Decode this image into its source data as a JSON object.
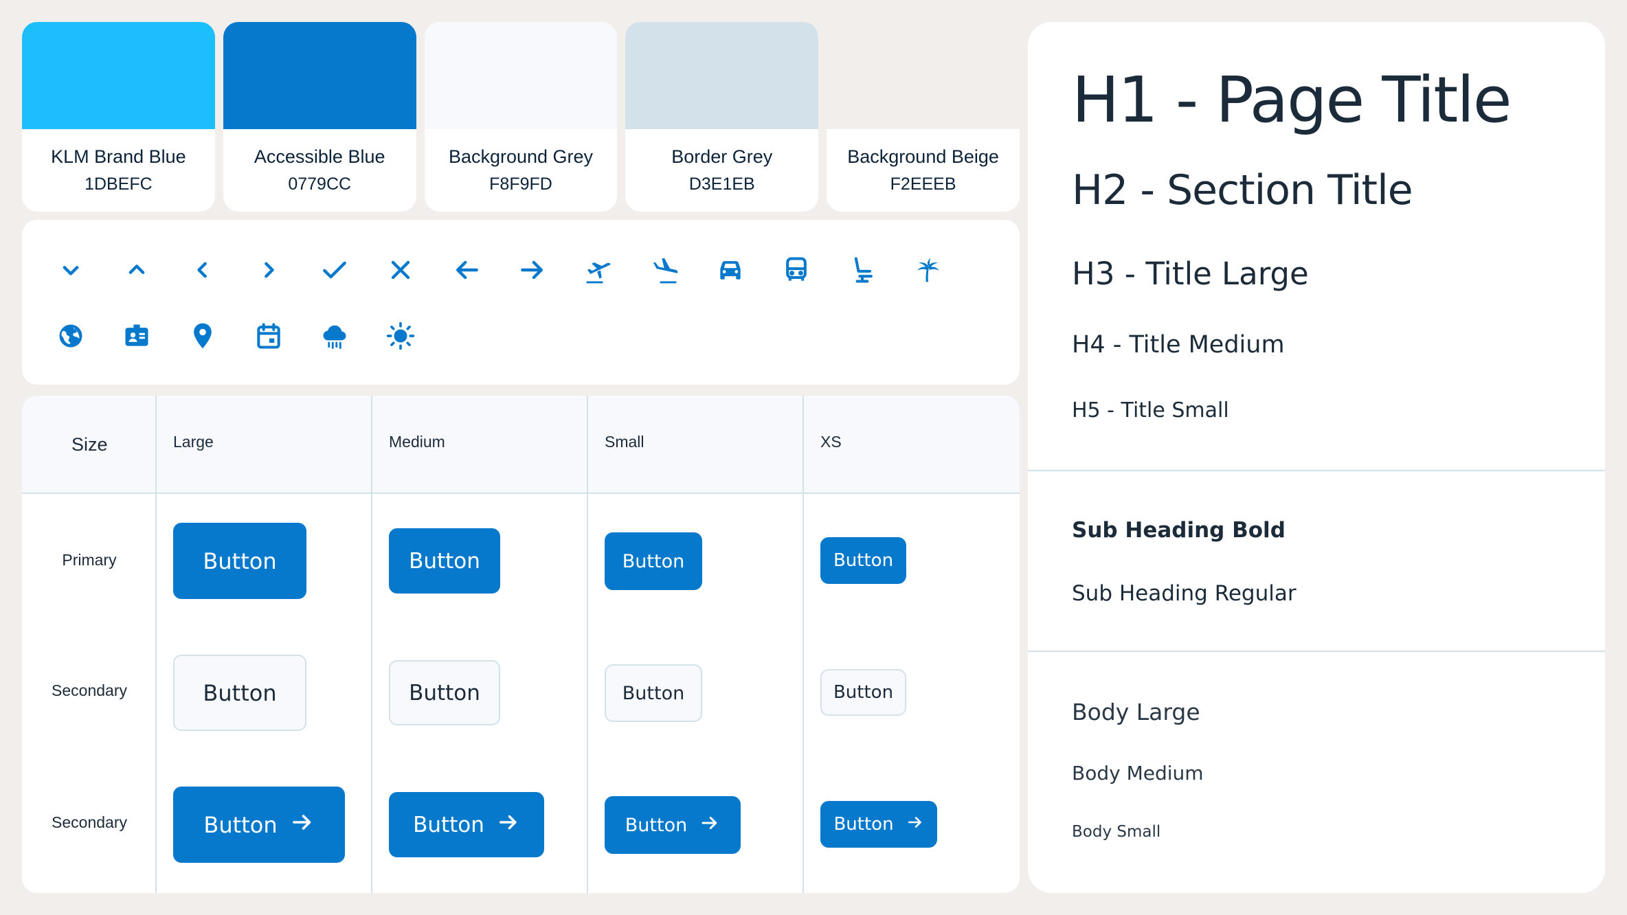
{
  "swatches": [
    {
      "name": "KLM Brand Blue",
      "hex": "1DBEFC",
      "color": "#1DBEFC"
    },
    {
      "name": "Accessible Blue",
      "hex": "0779CC",
      "color": "#0779CC"
    },
    {
      "name": "Background Grey",
      "hex": "F8F9FD",
      "color": "#F8F9FD"
    },
    {
      "name": "Border Grey",
      "hex": "D3E1EB",
      "color": "#D3E1EB"
    },
    {
      "name": "Background Beige",
      "hex": "F2EEEB",
      "color": "#F2EEEB"
    }
  ],
  "icons": [
    "chevron-down-icon",
    "chevron-up-icon",
    "chevron-left-icon",
    "chevron-right-icon",
    "checkmark-icon",
    "close-icon",
    "arrow-left-icon",
    "arrow-right-icon",
    "plane-takeoff-icon",
    "plane-landing-icon",
    "car-icon",
    "bus-icon",
    "seat-icon",
    "palm-tree-icon",
    "globe-icon",
    "id-badge-icon",
    "location-pin-icon",
    "calendar-icon",
    "rain-cloud-icon",
    "sun-icon"
  ],
  "table": {
    "headers": {
      "size": "Size",
      "large": "Large",
      "medium": "Medium",
      "small": "Small",
      "xs": "XS"
    },
    "rows": [
      {
        "label": "Primary"
      },
      {
        "label": "Secondary"
      },
      {
        "label": "Secondary"
      }
    ],
    "button_label": "Button"
  },
  "typography": {
    "h1": "H1 - Page Title",
    "h2": "H2 - Section Title",
    "h3": "H3 - Title Large",
    "h4": "H4 - Title Medium",
    "h5": "H5 - Title Small",
    "sub_bold": "Sub Heading Bold",
    "sub_regular": "Sub Heading Regular",
    "body_large": "Body Large",
    "body_medium": "Body Medium",
    "body_small": "Body Small"
  },
  "colors": {
    "accent": "#0779CC",
    "brand": "#1DBEFC",
    "border": "#D3E1EB",
    "background": "#F2EEEB",
    "surface_grey": "#F8F9FD"
  }
}
